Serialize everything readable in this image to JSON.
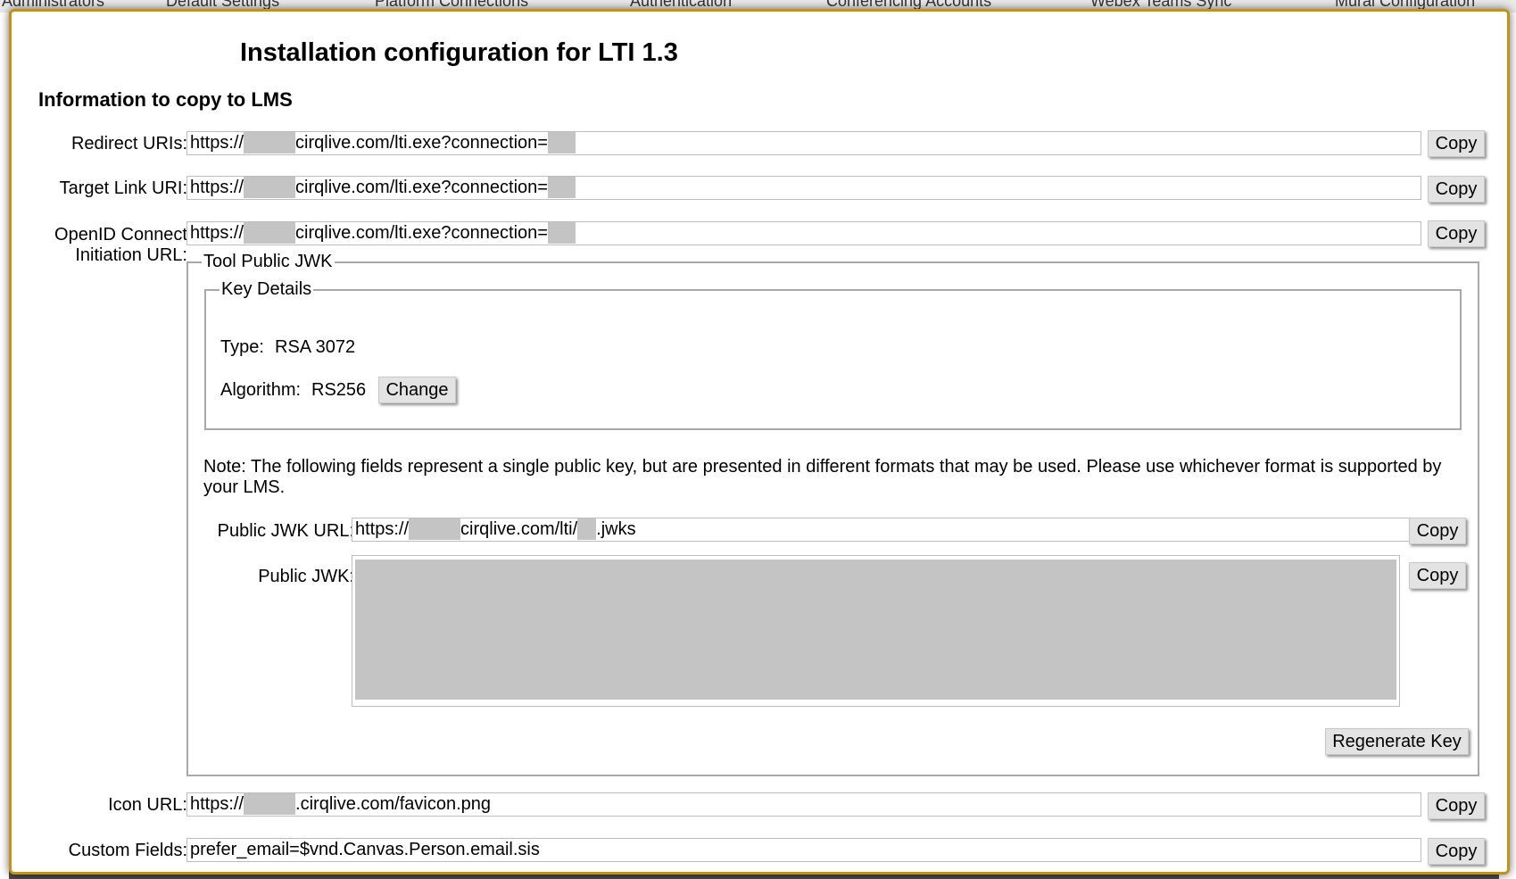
{
  "background_tabs": [
    "Administrators",
    "Default Settings",
    "Platform Connections",
    "Authentication",
    "Conferencing Accounts",
    "Webex Teams Sync",
    "Mural Configuration"
  ],
  "dialog": {
    "title": "Installation configuration for LTI 1.3",
    "section_heading": "Information to copy to LMS",
    "copy_label": "Copy",
    "fields": {
      "redirect_uris": {
        "label": "Redirect URIs:",
        "prefix": "https://",
        "suffix": "cirqlive.com/lti.exe?connection="
      },
      "target_link_uri": {
        "label": "Target Link URI:",
        "prefix": "https://",
        "suffix": "cirqlive.com/lti.exe?connection="
      },
      "openid_connect": {
        "label_line1": "OpenID Connect",
        "label_line2": "Initiation URL:",
        "prefix": "https://",
        "suffix": "cirqlive.com/lti.exe?connection="
      },
      "icon_url": {
        "label": "Icon URL:",
        "prefix": "https://",
        "suffix": ".cirqlive.com/favicon.png"
      },
      "custom_fields": {
        "label": "Custom Fields:",
        "value": "prefer_email=$vnd.Canvas.Person.email.sis"
      }
    },
    "tool_public_jwk": {
      "legend": "Tool Public JWK",
      "key_details": {
        "legend": "Key Details",
        "type_label": "Type:",
        "type_value": "RSA 3072",
        "algorithm_label": "Algorithm:",
        "algorithm_value": "RS256",
        "change_button": "Change"
      },
      "note": "Note: The following fields represent a single public key, but are presented in different formats that may be used. Please use whichever format is supported by your LMS.",
      "public_jwk_url": {
        "label": "Public JWK URL:",
        "prefix": "https://",
        "middle": "cirqlive.com/lti/",
        "suffix": ".jwks"
      },
      "public_jwk": {
        "label": "Public JWK:"
      },
      "regenerate_button": "Regenerate Key"
    }
  }
}
